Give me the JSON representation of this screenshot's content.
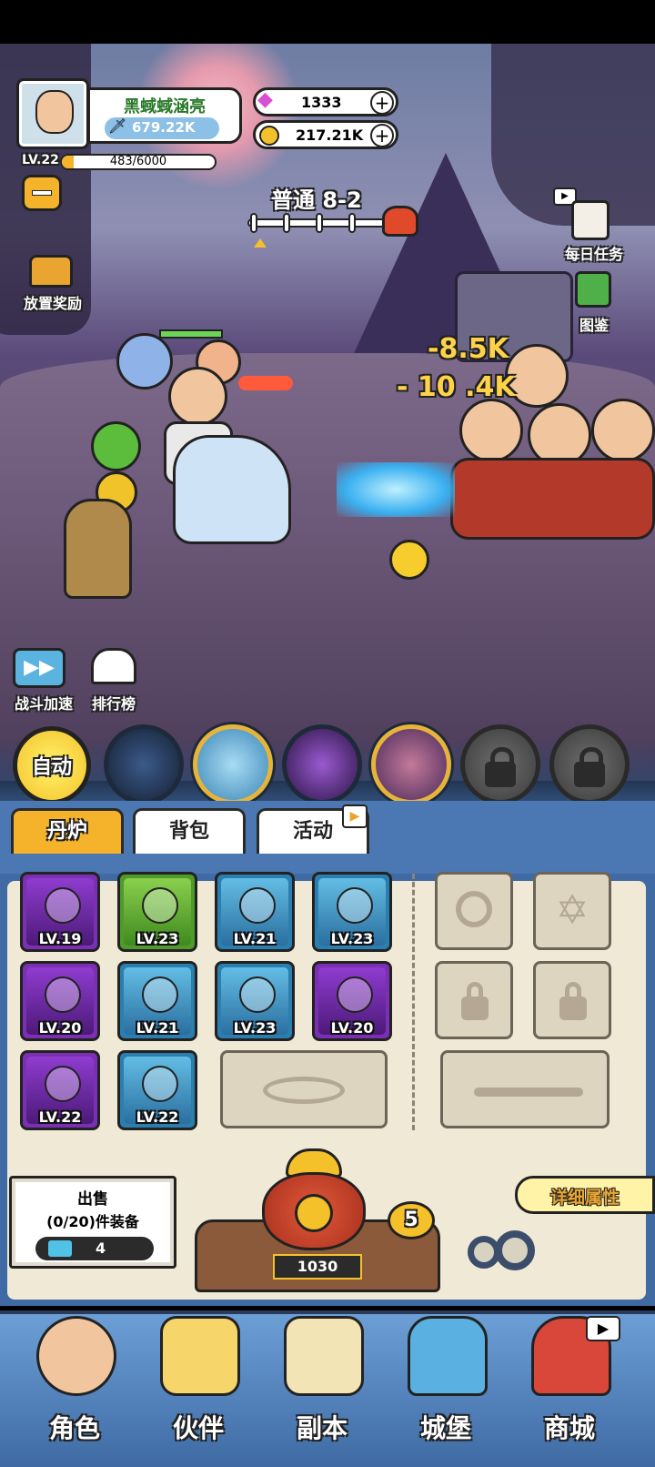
{
  "player": {
    "name": "黑蜮蜮涵亮",
    "power": "679.22K",
    "level": "LV.22",
    "exp": "483/6000",
    "exp_fraction": 0.08
  },
  "currency": {
    "gems": "1333",
    "gold": "217.21K"
  },
  "stage": {
    "label": "普通 8-2",
    "progress_fraction": 0.05
  },
  "side_buttons": {
    "idle_reward": "放置奖励",
    "daily_tasks": "每日任务",
    "codex": "图鉴",
    "battle_speed": "战斗加速",
    "leaderboard": "排行榜"
  },
  "battle": {
    "damage_1": "-8.5K",
    "damage_2": "- 10 .4K"
  },
  "skills": {
    "auto_label": "自动"
  },
  "tabs": [
    "丹炉",
    "背包",
    "活动"
  ],
  "equipment": [
    {
      "level": "LV.19",
      "rarity": "purple",
      "icon": "sword-icon"
    },
    {
      "level": "LV.23",
      "rarity": "green",
      "icon": "helmet-icon"
    },
    {
      "level": "LV.21",
      "rarity": "blue",
      "icon": "robe-icon"
    },
    {
      "level": "LV.23",
      "rarity": "blue",
      "icon": "orb-icon"
    },
    {
      "level": "LV.20",
      "rarity": "purple",
      "icon": "blade-icon"
    },
    {
      "level": "LV.21",
      "rarity": "blue",
      "icon": "jade-icon"
    },
    {
      "level": "LV.23",
      "rarity": "blue",
      "icon": "pendant-icon"
    },
    {
      "level": "LV.20",
      "rarity": "purple",
      "icon": "pearl-icon"
    },
    {
      "level": "LV.22",
      "rarity": "purple",
      "icon": "ring-icon"
    },
    {
      "level": "LV.22",
      "rarity": "blue",
      "icon": "boots-icon"
    }
  ],
  "sell": {
    "title": "出售",
    "count": "(0/20)件装备",
    "tickets": "4"
  },
  "furnace": {
    "value": "1030",
    "badge": "5"
  },
  "detail_button": "详细属性",
  "nav": [
    "角色",
    "伙伴",
    "副本",
    "城堡",
    "商城"
  ]
}
